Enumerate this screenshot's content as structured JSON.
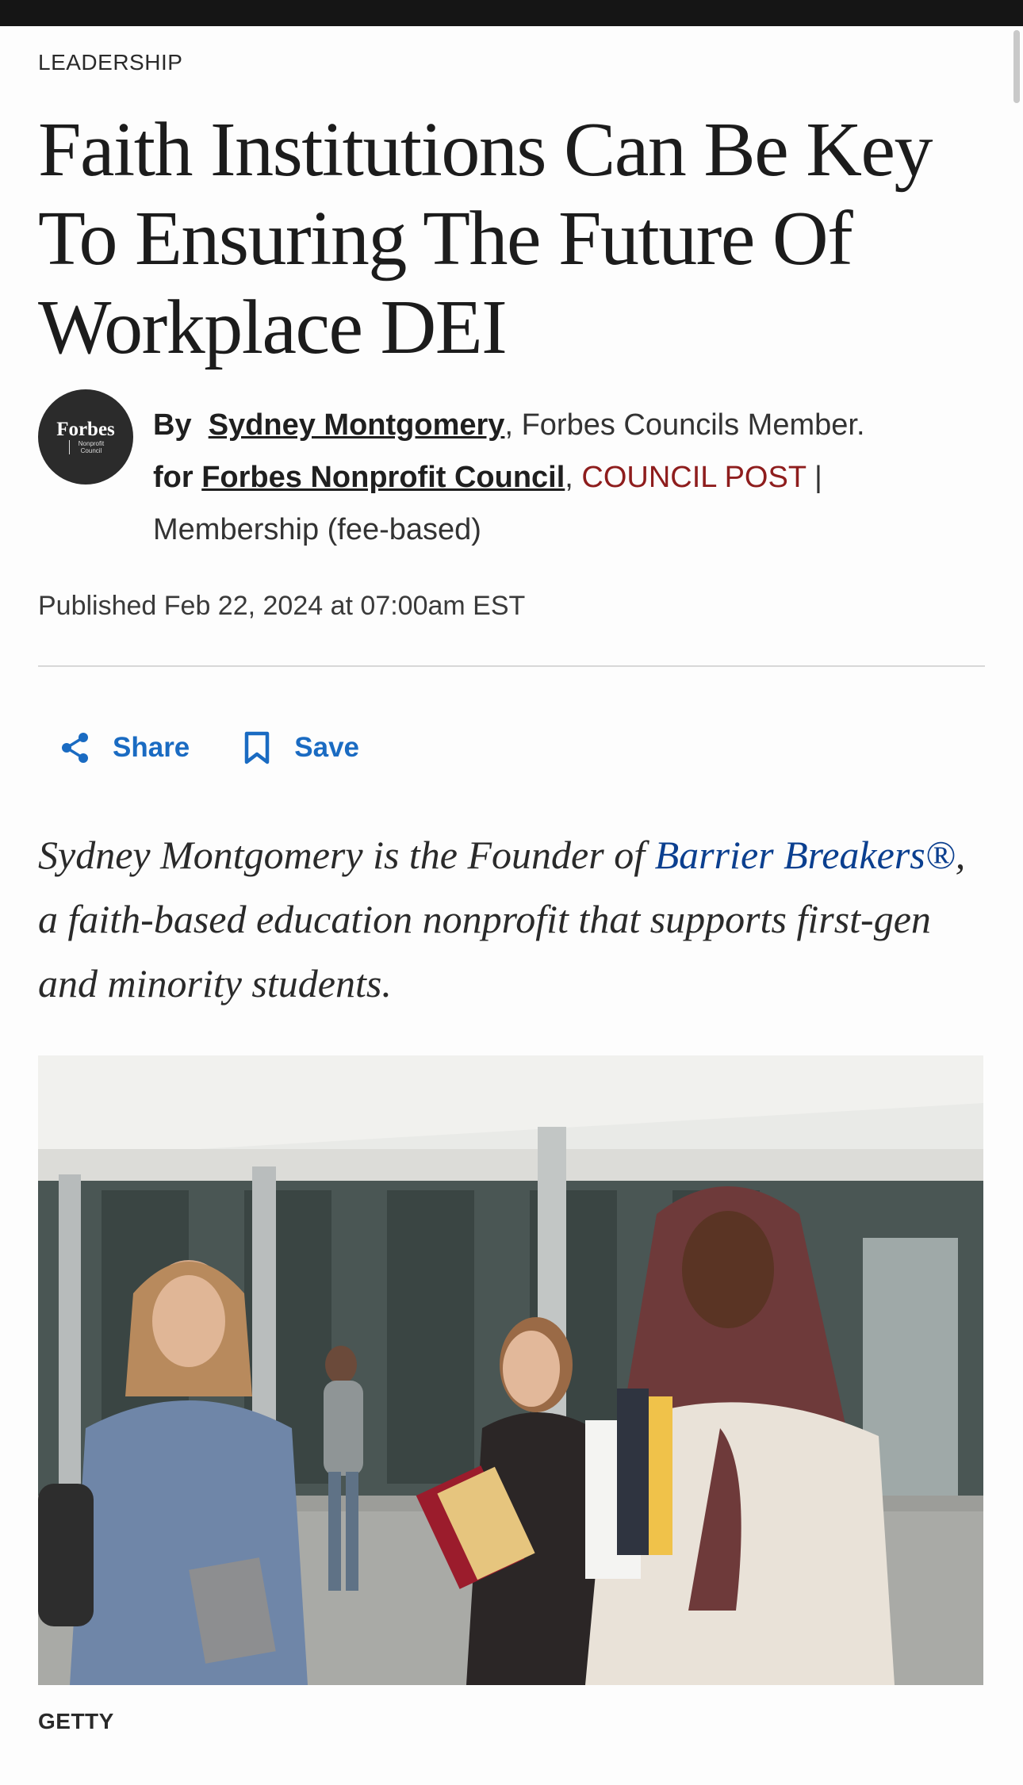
{
  "article": {
    "category": "LEADERSHIP",
    "headline": "Faith Institutions Can Be Key To Ensuring The Future Of Workplace DEI"
  },
  "author": {
    "avatar_brand": "Forbes",
    "avatar_sub": "Nonprofit Council",
    "by_label": "By",
    "name": "Sydney Montgomery",
    "role": "Forbes Councils Member.",
    "for_label": "for",
    "council": "Forbes Nonprofit Council",
    "post_type": "COUNCIL POST",
    "separator": "|",
    "membership": "Membership (fee-based)"
  },
  "published": "Published Feb 22, 2024 at 07:00am EST",
  "actions": {
    "share_label": "Share",
    "save_label": "Save"
  },
  "dek": {
    "prefix": "Sydney Montgomery is the Founder of ",
    "link": "Barrier Breakers®",
    "suffix": ", a faith-based education nonprofit that supports first-gen and minority students."
  },
  "photo": {
    "caption": "GETTY"
  },
  "colors": {
    "link_blue": "#1a6bc2",
    "council_red": "#8e1d1d",
    "dek_link": "#0b3f8f"
  }
}
